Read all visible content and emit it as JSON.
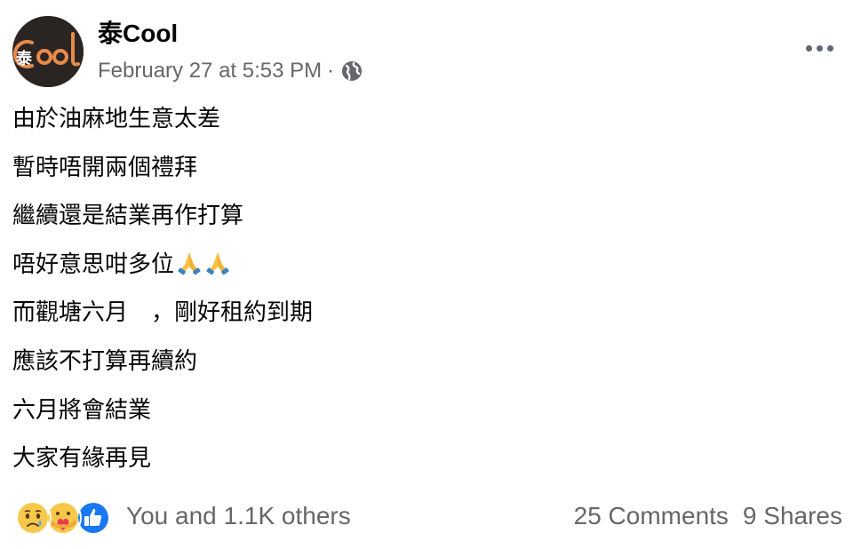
{
  "post": {
    "author": "泰Cool",
    "avatar_text": "泰Cool",
    "timestamp": "February 27 at 5:53 PM",
    "separator": "·",
    "privacy_icon": "globe-icon",
    "more_icon": "more-options-icon",
    "lines": [
      "由於油麻地生意太差",
      "暫時唔開兩個禮拜",
      "繼續還是結業再作打算",
      "唔好意思咁多位",
      "而觀塘六月　，剛好租約到期",
      "應該不打算再續約",
      "六月將會結業",
      "大家有緣再見"
    ],
    "line_4_emoji": "folded-hands-emoji ×2"
  },
  "footer": {
    "reactions": [
      "sad-reaction-icon",
      "care-reaction-icon",
      "like-reaction-icon"
    ],
    "reaction_count": "You and 1.1K others",
    "comments": "25 Comments",
    "shares": "9 Shares"
  },
  "colors": {
    "secondary_text": "#65676b",
    "primary_text": "#050505",
    "like_blue": "#1877f2",
    "avatar_bg": "#2a2523",
    "avatar_accent": "#e88a4a"
  }
}
